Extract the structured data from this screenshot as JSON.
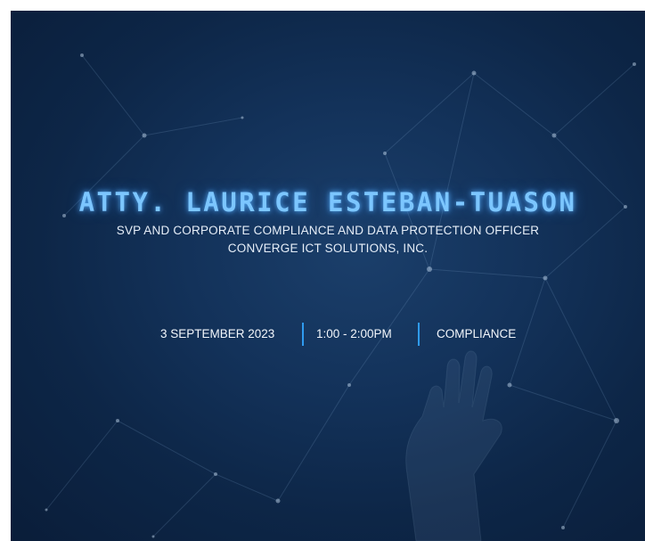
{
  "speaker": {
    "name": "ATTY. LAURICE ESTEBAN-TUASON",
    "role": "SVP AND CORPORATE COMPLIANCE AND DATA PROTECTION OFFICER",
    "company": "CONVERGE ICT SOLUTIONS, INC."
  },
  "session": {
    "date": "3 SEPTEMBER 2023",
    "time": "1:00 - 2:00PM",
    "topic": "COMPLIANCE"
  },
  "colors": {
    "background": "#13325a",
    "name_glow": "#7cc6ff",
    "divider": "#2f9bf0",
    "text": "#e6eef8"
  }
}
